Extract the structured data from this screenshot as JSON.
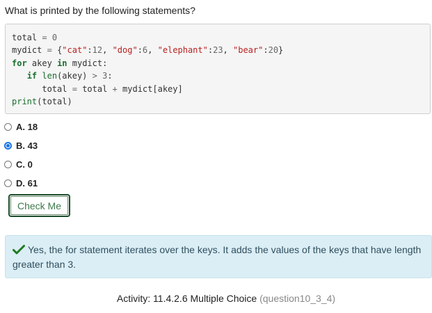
{
  "question": "What is printed by the following statements?",
  "code": {
    "l1a": "total",
    "l1b": "=",
    "l1c": "0",
    "l2a": "mydict",
    "l2b": "=",
    "l2_open": "{",
    "k1": "\"cat\"",
    "v1": "12",
    "k2": "\"dog\"",
    "v2": "6",
    "k3": "\"elephant\"",
    "v3": "23",
    "k4": "\"bear\"",
    "v4": "20",
    "l2_close": "}",
    "for_kw": "for",
    "l3_var": "akey",
    "in_kw": "in",
    "l3_rest": "mydict:",
    "if_kw": "if",
    "len_fn": "len",
    "l4_arg": "(akey)",
    "gt": ">",
    "l4_num": "3",
    "l4_colon": ":",
    "l5a": "total",
    "l5b": "=",
    "l5c": "total",
    "l5d": "+",
    "l5e": "mydict[akey]",
    "print_fn": "print",
    "l6_arg": "(total)"
  },
  "options": [
    {
      "label": "A. 18",
      "checked": false
    },
    {
      "label": "B. 43",
      "checked": true
    },
    {
      "label": "C. 0",
      "checked": false
    },
    {
      "label": "D. 61",
      "checked": false
    }
  ],
  "check_button_label": "Check Me",
  "feedback": {
    "icon": "check-icon",
    "text": "Yes, the for statement iterates over the keys. It adds the values of the keys that have length greater than 3.",
    "icon_color": "#1e7a1e"
  },
  "activity": {
    "label": "Activity: 11.4.2.6 Multiple Choice",
    "id": "(question10_3_4)"
  }
}
